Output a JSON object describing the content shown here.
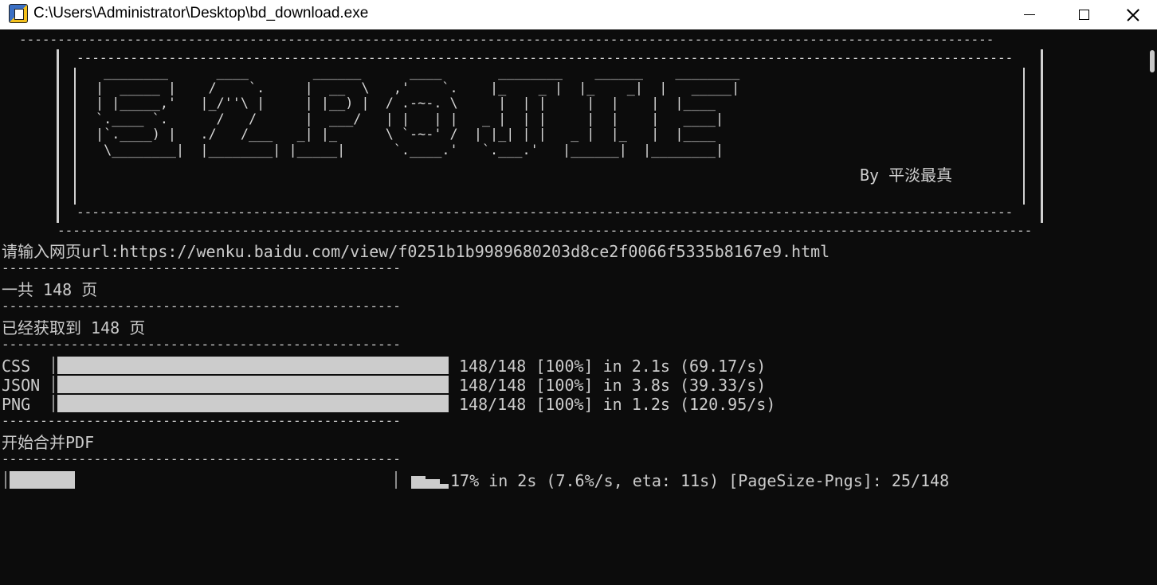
{
  "window": {
    "title": "C:\\Users\\Administrator\\Desktop\\bd_download.exe",
    "icon": "python-app-icon"
  },
  "banner": {
    "rule": "--------------------------------------------------------------------------------------------------------------------------------------------------------",
    "art": " ________      ____        ______      ____       ________    ______    ________\n|  _____ |    /    `.     |  __  \\   ,'    `.    |_    _ |  |_    _|  |   _____|\n| |_____,'   |_/''\\ |     | |__) |  / .-~-. \\     |  | |     |  |    |  |____ \n`.____ `.      /   /      |  ___/   | |   | |   _ |  | |     |  |    |   ____|\n|`.____) |   ./   /___   _| |_      \\ `-~-' /  | |_| | |   _ |  |_   |  |____ \n \\________|  |________| |_____|      `.____.'   `.___.'   |______|  |________|",
    "author": "By 平淡最真"
  },
  "terminal": {
    "prompt_label": "请输入网页url:",
    "prompt_value": "https://wenku.baidu.com/view/f0251b1b9989680203d8ce2f0066f5335b8167e9.html",
    "separator": "---------------------------------------------------------------",
    "total_pages": "一共 148 页",
    "fetched_pages": "已经获取到 148 页",
    "merge_message": "开始合并PDF"
  },
  "progress_bars": [
    {
      "label": "CSS",
      "fraction": 1.0,
      "stats": "148/148 [100%] in 2.1s (69.17/s)"
    },
    {
      "label": "JSON",
      "fraction": 1.0,
      "stats": "148/148 [100%] in 3.8s (39.33/s)"
    },
    {
      "label": "PNG",
      "fraction": 1.0,
      "stats": "148/148 [100%] in 1.2s (120.95/s)"
    }
  ],
  "merge_progress": {
    "fraction": 0.17,
    "stats": "17% in 2s (7.6%/s, eta: 11s) [PageSize-Pngs]: 25/148"
  },
  "colors": {
    "background": "#0c0c0c",
    "foreground": "#cccccc",
    "titlebar": "#ffffff"
  }
}
